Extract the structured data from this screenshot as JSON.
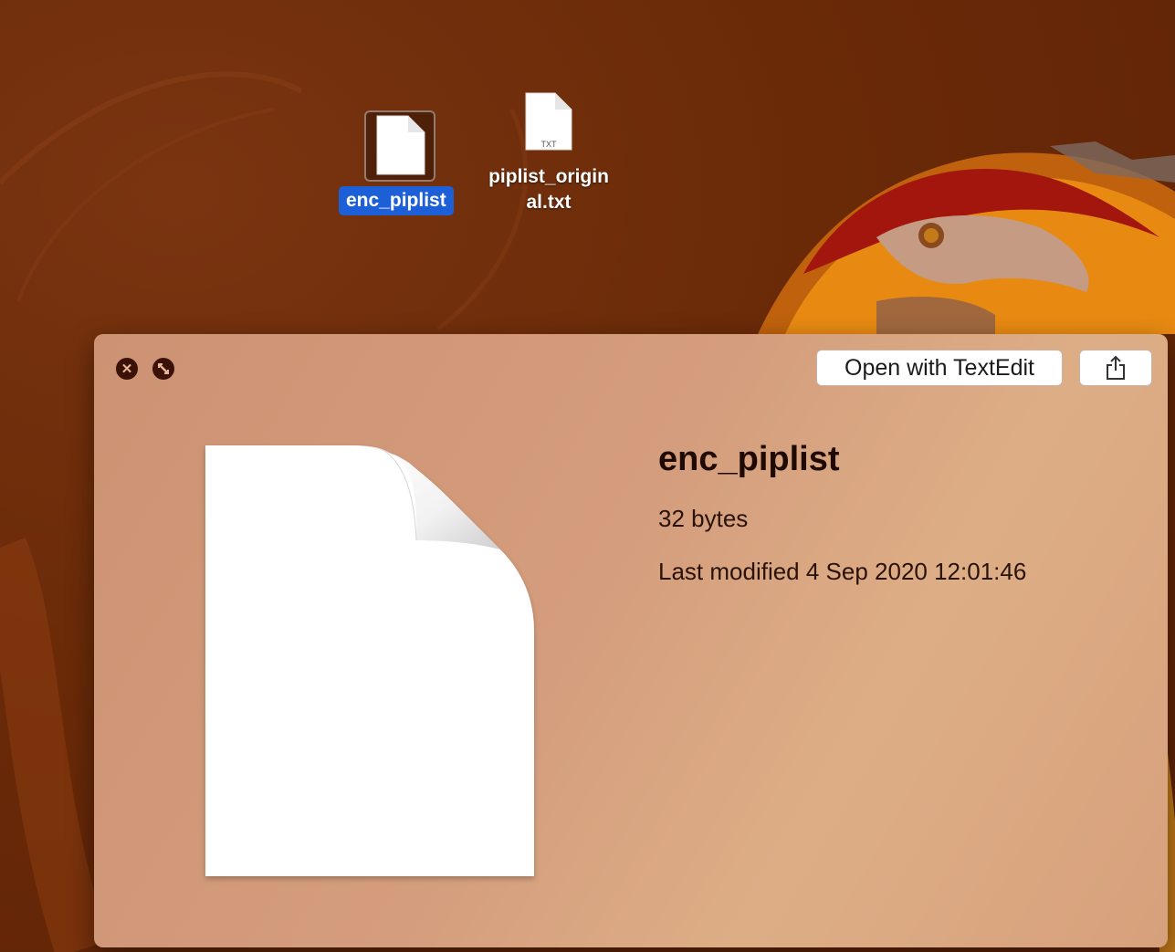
{
  "desktop": {
    "icons": [
      {
        "label": "enc_piplist",
        "selected": true,
        "icon": "document-icon"
      },
      {
        "label_line1": "piplist_origin",
        "label_line2": "al.txt",
        "badge": "TXT",
        "icon": "text-document-icon"
      }
    ]
  },
  "quicklook": {
    "open_button_label": "Open with TextEdit",
    "file_name": "enc_piplist",
    "file_size": "32 bytes",
    "last_modified": "Last modified 4 Sep 2020 12:01:46",
    "close_icon": "close-icon",
    "fullscreen_icon": "fullscreen-icon",
    "share_icon": "share-icon"
  },
  "colors": {
    "selection_blue": "#1d5fd6",
    "panel_tint": "#d49d7d"
  }
}
